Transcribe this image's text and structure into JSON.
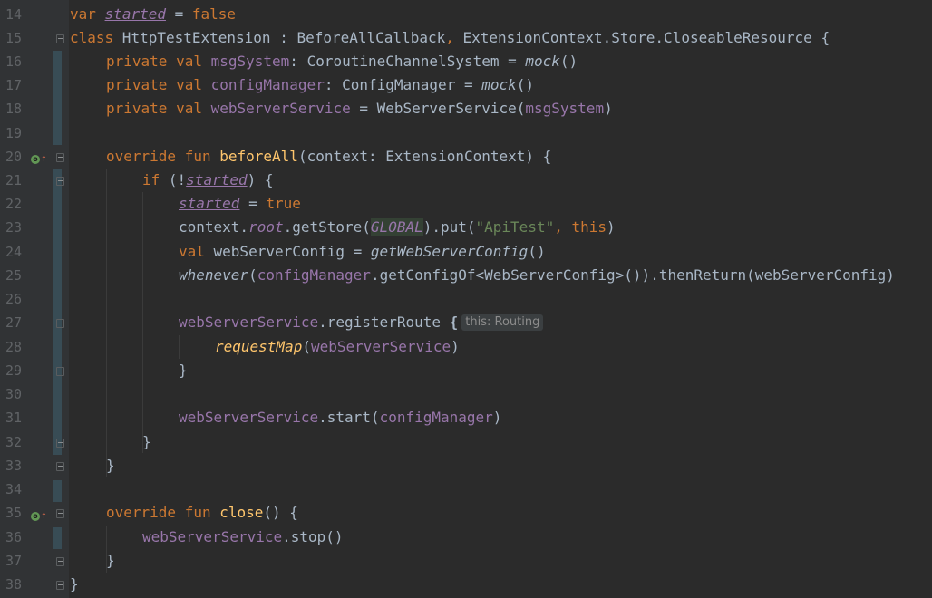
{
  "editor": {
    "line_numbers": [
      "14",
      "15",
      "16",
      "17",
      "18",
      "19",
      "20",
      "21",
      "22",
      "23",
      "24",
      "25",
      "26",
      "27",
      "28",
      "29",
      "30",
      "31",
      "32",
      "33",
      "34",
      "35",
      "36",
      "37",
      "38"
    ],
    "hint_text": "this: Routing",
    "tokens": {
      "l14_var": "var",
      "l14_started": "started",
      "l14_eq": " = ",
      "l14_false": "false",
      "l15_class": "class",
      "l15_rest": " HttpTestExtension : BeforeAllCallback",
      "l15_comma": ",",
      "l15_rest2": " ExtensionContext.Store.CloseableResource {",
      "l16_priv": "private val ",
      "l16_name": "msgSystem",
      "l16_type": ": CoroutineChannelSystem = ",
      "l16_mock": "mock",
      "l16_end": "()",
      "l17_priv": "private val ",
      "l17_name": "configManager",
      "l17_type": ": ConfigManager = ",
      "l17_mock": "mock",
      "l17_end": "()",
      "l18_priv": "private val ",
      "l18_name": "webServerService",
      "l18_type": " = WebServerService(",
      "l18_arg": "msgSystem",
      "l18_end": ")",
      "l20_kw": "override fun ",
      "l20_fn": "beforeAll",
      "l20_rest": "(context: ExtensionContext) {",
      "l21_if": "if ",
      "l21_open": "(!",
      "l21_started": "started",
      "l21_close": ") {",
      "l22_started": "started",
      "l22_eq": " = ",
      "l22_true": "true",
      "l23_a": "context.",
      "l23_root": "root",
      "l23_b": ".getStore(",
      "l23_global": "GLOBAL",
      "l23_c": ").put(",
      "l23_str": "\"ApiTest\"",
      "l23_comma": ", ",
      "l23_this": "this",
      "l23_end": ")",
      "l24_val": "val ",
      "l24_rest": "webServerConfig = ",
      "l24_fn": "getWebServerConfig",
      "l24_end": "()",
      "l25_whenever": "whenever",
      "l25_a": "(",
      "l25_cm": "configManager",
      "l25_rest": ".getConfigOf<WebServerConfig>()).thenReturn(webServerConfig)",
      "l27_ws": "webServerService",
      "l27_rest": ".registerRoute ",
      "l27_brace": "{",
      "l28_fn": "requestMap",
      "l28_a": "(",
      "l28_ws": "webServerService",
      "l28_end": ")",
      "l29_close": "}",
      "l31_ws": "webServerService",
      "l31_a": ".start(",
      "l31_cm": "configManager",
      "l31_end": ")",
      "l32_close": "}",
      "l33_close": "}",
      "l35_kw": "override fun ",
      "l35_fn": "close",
      "l35_rest": "() {",
      "l36_ws": "webServerService",
      "l36_rest": ".stop()",
      "l37_close": "}",
      "l38_close": "}"
    }
  },
  "colors": {
    "background": "#2b2b2b",
    "gutter": "#313335",
    "keyword": "#cc7832",
    "property": "#9876aa",
    "function": "#ffc66d",
    "string": "#6a8759",
    "text": "#a9b7c6"
  }
}
